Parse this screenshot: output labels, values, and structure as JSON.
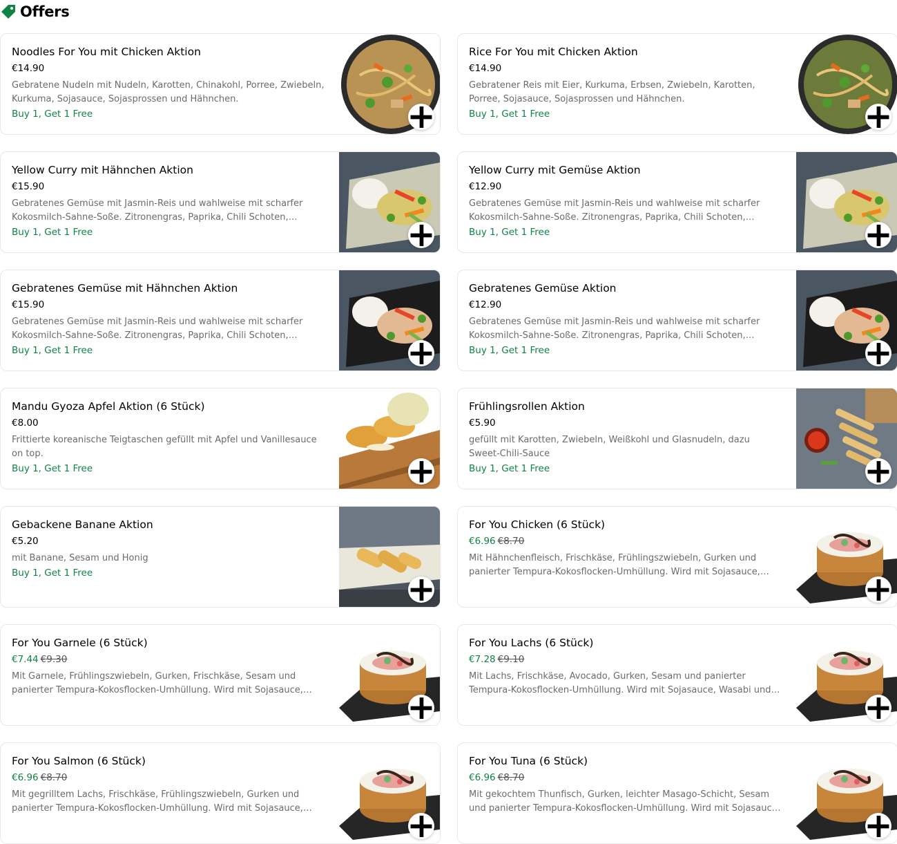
{
  "section": {
    "title": "Offers",
    "icon": "tag-icon",
    "accent": "#0e8345"
  },
  "items": [
    {
      "title": "Noodles For You mit Chicken Aktion",
      "price": "€14.90",
      "old_price": "",
      "description": "Gebratene Nudeln mit Nudeln, Karotten, Chinakohl, Porree, Zwiebeln, Kurkuma, Sojasauce, Sojasprossen und Hähnchen.",
      "promo": "Buy 1, Get 1 Free",
      "image": "noodles-bowl"
    },
    {
      "title": "Rice For You mit Chicken Aktion",
      "price": "€14.90",
      "old_price": "",
      "description": "Gebratener Reis mit Eier, Kurkuma, Erbsen, Zwiebeln, Karotten, Porree, Sojasauce, Sojasprossen und Hähnchen.",
      "promo": "Buy 1, Get 1 Free",
      "image": "rice-bowl"
    },
    {
      "title": "Yellow Curry mit Hähnchen Aktion",
      "price": "€15.90",
      "old_price": "",
      "description": "Gebratenes Gemüse mit Jasmin-Reis und wahlweise mit scharfer Kokosmilch-Sahne-Soße. Zitronengras, Paprika, Chili Schoten, Bambus",
      "promo": "Buy 1, Get 1 Free",
      "image": "curry-plate"
    },
    {
      "title": "Yellow Curry mit Gemüse Aktion",
      "price": "€12.90",
      "old_price": "",
      "description": "Gebratenes Gemüse mit Jasmin-Reis und wahlweise mit scharfer Kokosmilch-Sahne-Soße. Zitronengras, Paprika, Chili Schoten, Bambus",
      "promo": "Buy 1, Get 1 Free",
      "image": "curry-plate-veg"
    },
    {
      "title": "Gebratenes Gemüse mit Hähnchen Aktion",
      "price": "€15.90",
      "old_price": "",
      "description": "Gebratenes Gemüse mit Jasmin-Reis und wahlweise mit scharfer Kokosmilch-Sahne-Soße. Zitronengras, Paprika, Chili Schoten, Bambus",
      "promo": "Buy 1, Get 1 Free",
      "image": "veg-plate"
    },
    {
      "title": "Gebratenes Gemüse Aktion",
      "price": "€12.90",
      "old_price": "",
      "description": "Gebratenes Gemüse mit Jasmin-Reis und wahlweise mit scharfer Kokosmilch-Sahne-Soße. Zitronengras, Paprika, Chili Schoten, Bambus",
      "promo": "Buy 1, Get 1 Free",
      "image": "veg-plate"
    },
    {
      "title": "Mandu Gyoza Apfel Aktion (6 Stück)",
      "price": "€8.00",
      "old_price": "",
      "description": "Frittierte koreanische Teigtaschen gefüllt mit Apfel und Vanillesauce on top.",
      "promo": "Buy 1, Get 1 Free",
      "image": "gyoza-board"
    },
    {
      "title": "Frühlingsrollen Aktion",
      "price": "€5.90",
      "old_price": "",
      "description": "gefüllt mit Karotten, Zwiebeln, Weißkohl und Glasnudeln, dazu Sweet-Chili-Sauce",
      "promo": "Buy 1, Get 1 Free",
      "image": "spring-rolls"
    },
    {
      "title": "Gebackene Banane Aktion",
      "price": "€5.20",
      "old_price": "",
      "description": "mit Banane, Sesam und Honig",
      "promo": "Buy 1, Get 1 Free",
      "image": "baked-banana"
    },
    {
      "title": "For You Chicken (6 Stück)",
      "price": "€6.96",
      "old_price": "€8.70",
      "description": "Mit Hähnchenfleisch, Frischkäse, Frühlingszwiebeln, Gurken und panierter Tempura-Kokosflocken-Umhüllung. Wird mit Sojasauce, Wasabi und Ingwer serviert.",
      "promo": "",
      "image": "sushi-roll"
    },
    {
      "title": "For You Garnele (6 Stück)",
      "price": "€7.44",
      "old_price": "€9.30",
      "description": "Mit Garnele, Frühlingszwiebeln, Gurken, Frischkäse, Sesam und panierter Tempura-Kokosflocken-Umhüllung. Wird mit Sojasauce, Wasabi und Ingwer serviert.",
      "promo": "",
      "image": "sushi-roll"
    },
    {
      "title": "For You Lachs (6 Stück)",
      "price": "€7.28",
      "old_price": "€9.10",
      "description": "Mit Lachs, Frischkäse, Avocado, Gurken, Sesam und panierter Tempura-Kokosflocken-Umhüllung. Wird mit Sojasauce, Wasabi und Ingwer serviert.",
      "promo": "",
      "image": "sushi-roll"
    },
    {
      "title": "For You Salmon (6 Stück)",
      "price": "€6.96",
      "old_price": "€8.70",
      "description": "Mit gegrilltem Lachs, Frischkäse, Frühlingszwiebeln, Gurken und panierter Tempura-Kokosflocken-Umhüllung. Wird mit Sojasauce, Wasabi und Ingwer serviert.",
      "promo": "",
      "image": "sushi-roll"
    },
    {
      "title": "For You Tuna (6 Stück)",
      "price": "€6.96",
      "old_price": "€8.70",
      "description": "Mit gekochtem Thunfisch, Gurken, leichter Masago-Schicht, Sesam und panierter Tempura-Kokosflocken-Umhüllung. Wird mit Sojasauce, Wasabi und Ingwer serviert.",
      "promo": "",
      "image": "sushi-roll"
    }
  ]
}
